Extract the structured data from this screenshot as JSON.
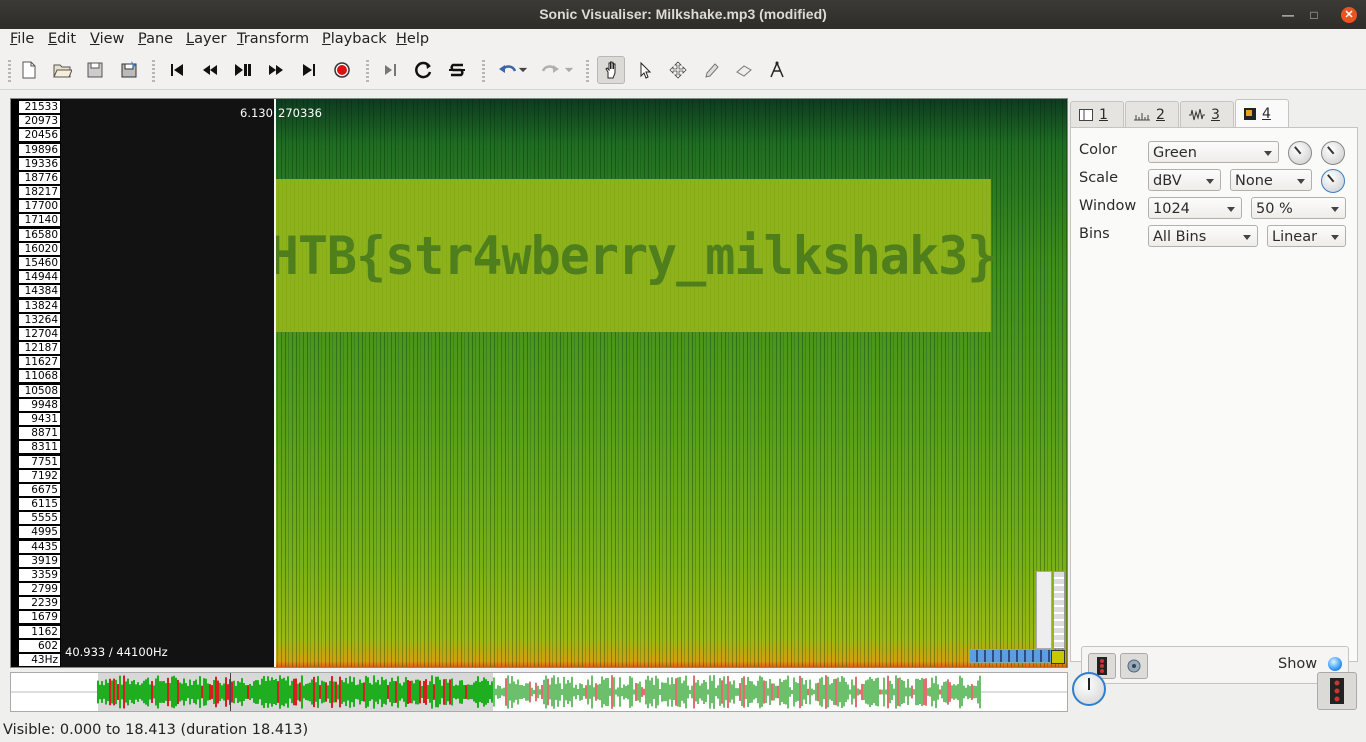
{
  "window": {
    "title": "Sonic Visualiser: Milkshake.mp3 (modified)"
  },
  "menu": [
    "File",
    "Edit",
    "View",
    "Pane",
    "Layer",
    "Transform",
    "Playback",
    "Help"
  ],
  "toolbar": {
    "icons": [
      "new-file-icon",
      "open-folder-icon",
      "save-icon",
      "save-session-icon",
      "rewind-start-icon",
      "rewind-icon",
      "play-pause-icon",
      "fast-forward-icon",
      "forward-end-icon",
      "record-icon",
      "constrain-playback-icon",
      "loop-icon",
      "solo-icon",
      "undo-icon",
      "redo-icon",
      "navigate-hand-icon",
      "select-arrow-icon",
      "move-icon",
      "draw-pencil-icon",
      "erase-icon",
      "measure-icon"
    ]
  },
  "pane": {
    "freq_ticks": [
      "21533",
      "20973",
      "20456",
      "19896",
      "19336",
      "18776",
      "18217",
      "17700",
      "17140",
      "16580",
      "16020",
      "15460",
      "14944",
      "14384",
      "13824",
      "13264",
      "12704",
      "12187",
      "11627",
      "11068",
      "10508",
      "9948",
      "9431",
      "8871",
      "8311",
      "7751",
      "7192",
      "6675",
      "6115",
      "5555",
      "4995",
      "4435",
      "3919",
      "3359",
      "2799",
      "2239",
      "1679",
      "1162",
      "602",
      "43Hz"
    ],
    "cursor_time": "6.130",
    "cursor_frame": "270336",
    "freq_readout": "40.933 / 44100Hz",
    "hidden_message": "HTB{str4wberry_milkshak3}"
  },
  "panel": {
    "tabs": [
      {
        "num": "1",
        "icon": "pane-icon"
      },
      {
        "num": "2",
        "icon": "ruler-icon"
      },
      {
        "num": "3",
        "icon": "waveform-icon"
      },
      {
        "num": "4",
        "icon": "spectrogram-icon"
      }
    ],
    "active_tab": "4",
    "color_label": "Color",
    "color_value": "Green",
    "scale_label": "Scale",
    "scale_value": "dBV",
    "normalize_value": "None",
    "window_label": "Window",
    "window_value": "1024",
    "overlap_value": "50 %",
    "bins_label": "Bins",
    "bins_value": "All Bins",
    "binscale_value": "Linear",
    "show_label": "Show"
  },
  "status": {
    "text": "Visible: 0.000 to 18.413 (duration 18.413)"
  }
}
